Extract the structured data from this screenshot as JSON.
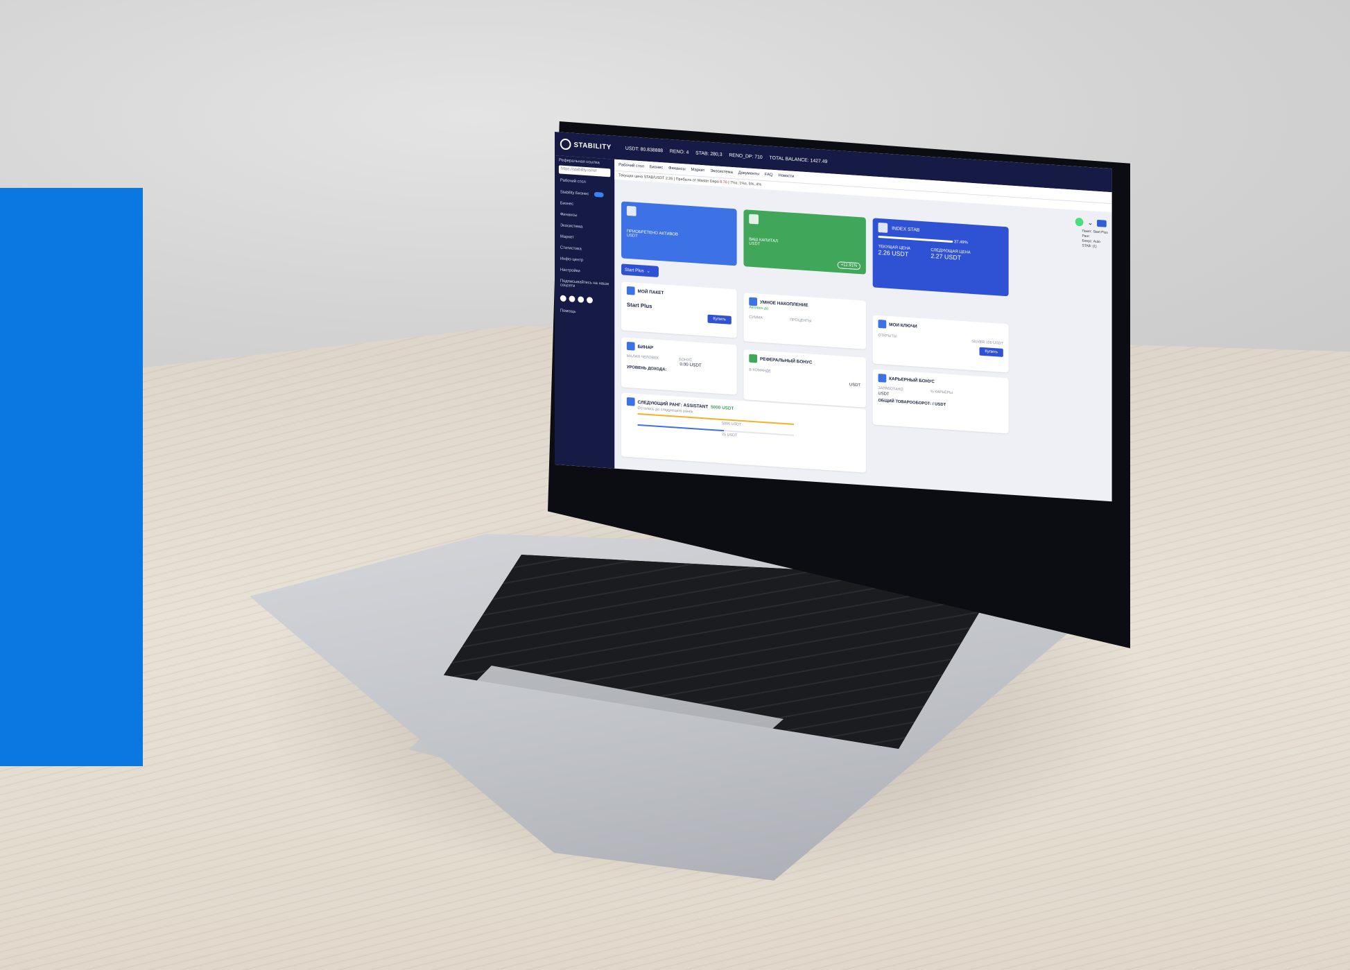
{
  "topbar": {
    "logo_text": "STABILITY",
    "balances": [
      "USDT: 80.838888",
      "RENO: 4",
      "STAB: 280,3",
      "RENO_DP: 710",
      "TOTAL BALANCE: 1427.49"
    ]
  },
  "sidebar": {
    "ref_label": "Реферальная ссылка",
    "ref_placeholder": "https://stability.io/ref",
    "items": [
      "Рабочий стол",
      "Stability Бизнес",
      "Бизнес",
      "Финансы",
      "Экосистема",
      "Маркет",
      "Статистика",
      "Инфо-центр",
      "Настройки"
    ],
    "subscribe_label": "Подписывайтесь на наши соцсети",
    "help_label": "Помощь"
  },
  "tabs": [
    "Рабочий стол",
    "Бизнес",
    "Финансы",
    "Маркет",
    "Экосистема",
    "Документы",
    "FAQ",
    "Новости"
  ],
  "ticker": {
    "text": "Текущая цена STAB/USDT 2.26 | Прибыль от Master Depo",
    "highlight": "8.76",
    "rest": "| 7%з, 1%з, 5%, 4%"
  },
  "side_info": [
    "Пакет: Start Plus",
    "Ранг:",
    "Бонус: Auto",
    "STAB: (1)"
  ],
  "cards": {
    "acquired_label": "ПРИОБРЕТЕНО АКТИВОВ",
    "acquired_unit": "USDT",
    "capital_label": "ВАШ КАПИТАЛ",
    "capital_unit": "USDT",
    "capital_change": "+12.91%",
    "index_title": "INDEX STAB",
    "index_percent": "37.49%",
    "current_price_label": "ТЕКУЩАЯ ЦЕНА",
    "current_price": "2.26 USDT",
    "next_price_label": "СЛЕДУЮЩАЯ ЦЕНА",
    "next_price": "2.27 USDT"
  },
  "package_select": "Start Plus",
  "widgets": {
    "my_package_title": "МОЙ ПАКЕТ",
    "my_package_value": "Start Plus",
    "buy_label": "Купить",
    "smart_title": "УМНОЕ НАКОПЛЕНИЕ",
    "smart_subtitle": "Активен до",
    "smart_sum": "СУММА",
    "smart_percent": "ПРОЦЕНТЫ",
    "keys_title": "МОИ КЛЮЧИ",
    "keys_opened": "ОТКРЫТЫ",
    "keys_silver": "SILVER 100 USDT",
    "binar_title": "БИНАР",
    "binar_people": "МАЛАЯ ЧЕЛОВЕК",
    "binar_bonus": "БОНУС",
    "binar_bonus_value": "0.00 USDT",
    "binar_level": "УРОВЕНЬ ДОХОДА:",
    "ref_bonus_title": "РЕФЕРАЛЬНЫЙ БОНУС",
    "ref_team": "В КОМАНДЕ",
    "ref_unit": "USDT",
    "career_title": "КАРЬЕРНЫЙ БОНУС",
    "career_earned": "ЗАРАБОТАНО",
    "career_unit": "USDT",
    "career_percent": "% КАРЬЕРЫ",
    "career_turnover": "ОБЩИЙ ТОВАРООБОРОТ:",
    "career_turnover_unit": "/ USDT",
    "next_rank_title": "СЛЕДУЮЩИЙ РАНГ: ASSISTANT",
    "next_rank_amount": "5000 USDT",
    "next_rank_note": "Осталось до следующего ранга",
    "progress1_label": "5000 USDT",
    "progress2_label": "75 USDT"
  },
  "colors": {
    "navy": "#161b45",
    "blue": "#3c72e6",
    "green": "#3fa65a",
    "index": "#2f52d4",
    "brand_panel": "#0a78e0",
    "gold": "#f0b429"
  }
}
